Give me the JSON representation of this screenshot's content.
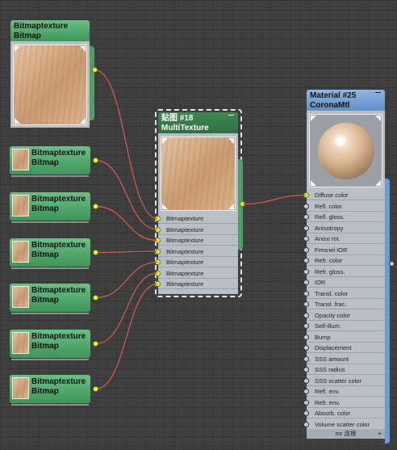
{
  "bitmap_nodes": [
    {
      "title": "Bitmaptexture",
      "subtitle": "Bitmap"
    },
    {
      "title": "Bitmaptexture",
      "subtitle": "Bitmap"
    },
    {
      "title": "Bitmaptexture",
      "subtitle": "Bitmap"
    },
    {
      "title": "Bitmaptexture",
      "subtitle": "Bitmap"
    },
    {
      "title": "Bitmaptexture",
      "subtitle": "Bitmap"
    },
    {
      "title": "Bitmaptexture",
      "subtitle": "Bitmap"
    },
    {
      "title": "Bitmaptexture",
      "subtitle": "Bitmap"
    }
  ],
  "multitexture": {
    "title": "贴图 #18",
    "subtitle": "MultiTexture",
    "slots": [
      "Bitmaptexture",
      "Bitmaptexture",
      "Bitmaptexture",
      "Bitmaptexture",
      "Bitmaptexture",
      "Bitmaptexture",
      "Bitmaptexture"
    ]
  },
  "material": {
    "title": "Material #25",
    "subtitle": "CoronaMtl",
    "slots": [
      "Diffuse color",
      "Refl. color",
      "Refl. gloss.",
      "Anisotropy",
      "Aniso rot.",
      "Fresnel IOR",
      "Refr. color",
      "Refr. gloss.",
      "IOR",
      "Transl. color",
      "Transl. frac.",
      "Opacity color",
      "Self-illum.",
      "Bump",
      "Displacement",
      "SSS amount",
      "SSS radius",
      "SSS scatter color",
      "Refl. env.",
      "Refr. env.",
      "Absorb. color",
      "Volume scatter color"
    ],
    "footer": "mr 连接"
  },
  "colors": {
    "header_green": "#4f9d67",
    "material_header": "#6b9bd1",
    "wire": "#e05a4e",
    "port_active": "#e6ff3a",
    "node_body": "#b9bfc6"
  }
}
